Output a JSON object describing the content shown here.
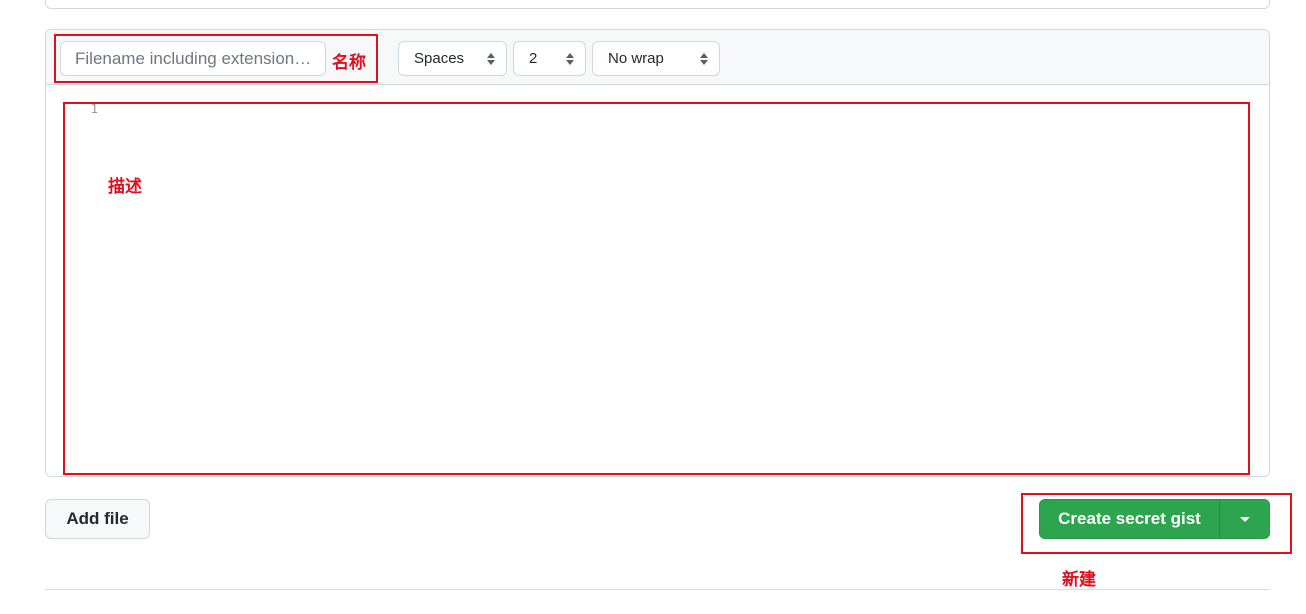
{
  "file_header": {
    "filename_placeholder": "Filename including extension…",
    "filename_value": "",
    "indent_mode": {
      "selected": "Spaces"
    },
    "indent_size": {
      "selected": "2"
    },
    "wrap_mode": {
      "selected": "No wrap"
    }
  },
  "editor": {
    "line_numbers": [
      "1"
    ],
    "content": ""
  },
  "actions": {
    "add_file_label": "Add file",
    "create_label": "Create secret gist"
  },
  "annotations": {
    "name_label": "名称",
    "description_label": "描述",
    "create_label": "新建",
    "color": "#e0101e"
  },
  "colors": {
    "primary_button": "#2da44e",
    "header_background": "#f6f8fa",
    "border": "#d0d7de"
  },
  "icons": {
    "select_caret": "up-down-caret-icon",
    "dropdown": "triangle-down-icon"
  }
}
